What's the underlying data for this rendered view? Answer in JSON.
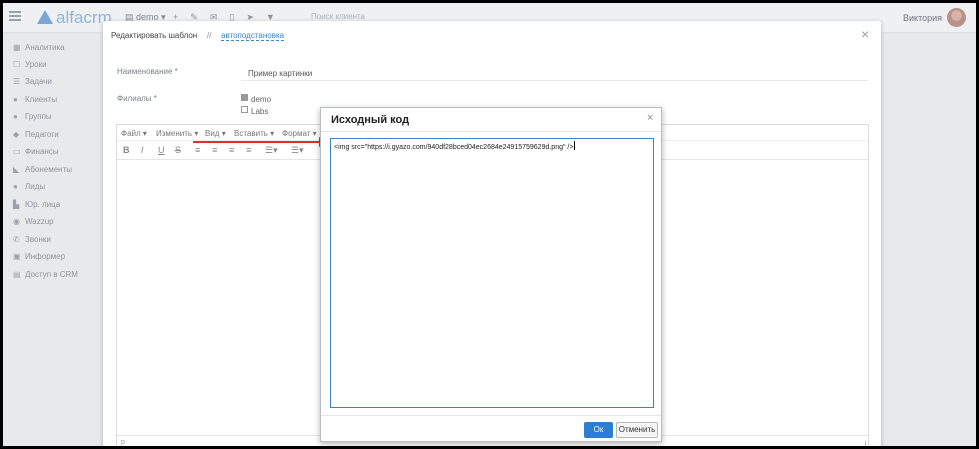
{
  "topbar": {
    "logo": "alfacrm",
    "branch": "demo",
    "search_placeholder": "Поиск клиента",
    "user": "Виктория",
    "icons": [
      "plus-icon",
      "wrench-icon",
      "mail-icon",
      "phone-icon",
      "send-icon",
      "filter-icon"
    ]
  },
  "sidebar": {
    "items": [
      {
        "label": "Аналитика",
        "icon": "dashboard-icon"
      },
      {
        "label": "Уроки",
        "icon": "calendar-icon"
      },
      {
        "label": "Задачи",
        "icon": "tasks-icon"
      },
      {
        "label": "Клиенты",
        "icon": "user-icon"
      },
      {
        "label": "Группы",
        "icon": "users-icon"
      },
      {
        "label": "Педагоги",
        "icon": "graduation-cap-icon"
      },
      {
        "label": "Финансы",
        "icon": "money-icon"
      },
      {
        "label": "Абонементы",
        "icon": "tag-icon"
      },
      {
        "label": "Лиды",
        "icon": "user-plus-icon"
      },
      {
        "label": "Юр. лица",
        "icon": "building-icon"
      },
      {
        "label": "Wazzup",
        "icon": "whatsapp-icon"
      },
      {
        "label": "Звонки",
        "icon": "phone-icon"
      },
      {
        "label": "Информер",
        "icon": "informer-icon"
      },
      {
        "label": "Доступ в CRM",
        "icon": "lock-icon"
      }
    ]
  },
  "template_modal": {
    "title": "Редактировать шаблон",
    "separator": "//",
    "link": "автоподстановка",
    "name_label": "Наименование *",
    "name_value": "Пример картинки",
    "branches_label": "Филиалы *",
    "branches": [
      {
        "label": "demo",
        "checked": true
      },
      {
        "label": "Labs",
        "checked": false
      }
    ],
    "editor": {
      "menus": [
        "Файл",
        "Изменить",
        "Вид",
        "Вставить",
        "Формат"
      ],
      "toolbar": [
        "B",
        "I",
        "U",
        "S"
      ],
      "status": "p"
    }
  },
  "source_dialog": {
    "title": "Исходный код",
    "code": "<img src=\"https://i.gyazo.com/940df28bced04ec2684e24915759629d.png\" />",
    "ok_label": "Ок",
    "cancel_label": "Отменить"
  }
}
